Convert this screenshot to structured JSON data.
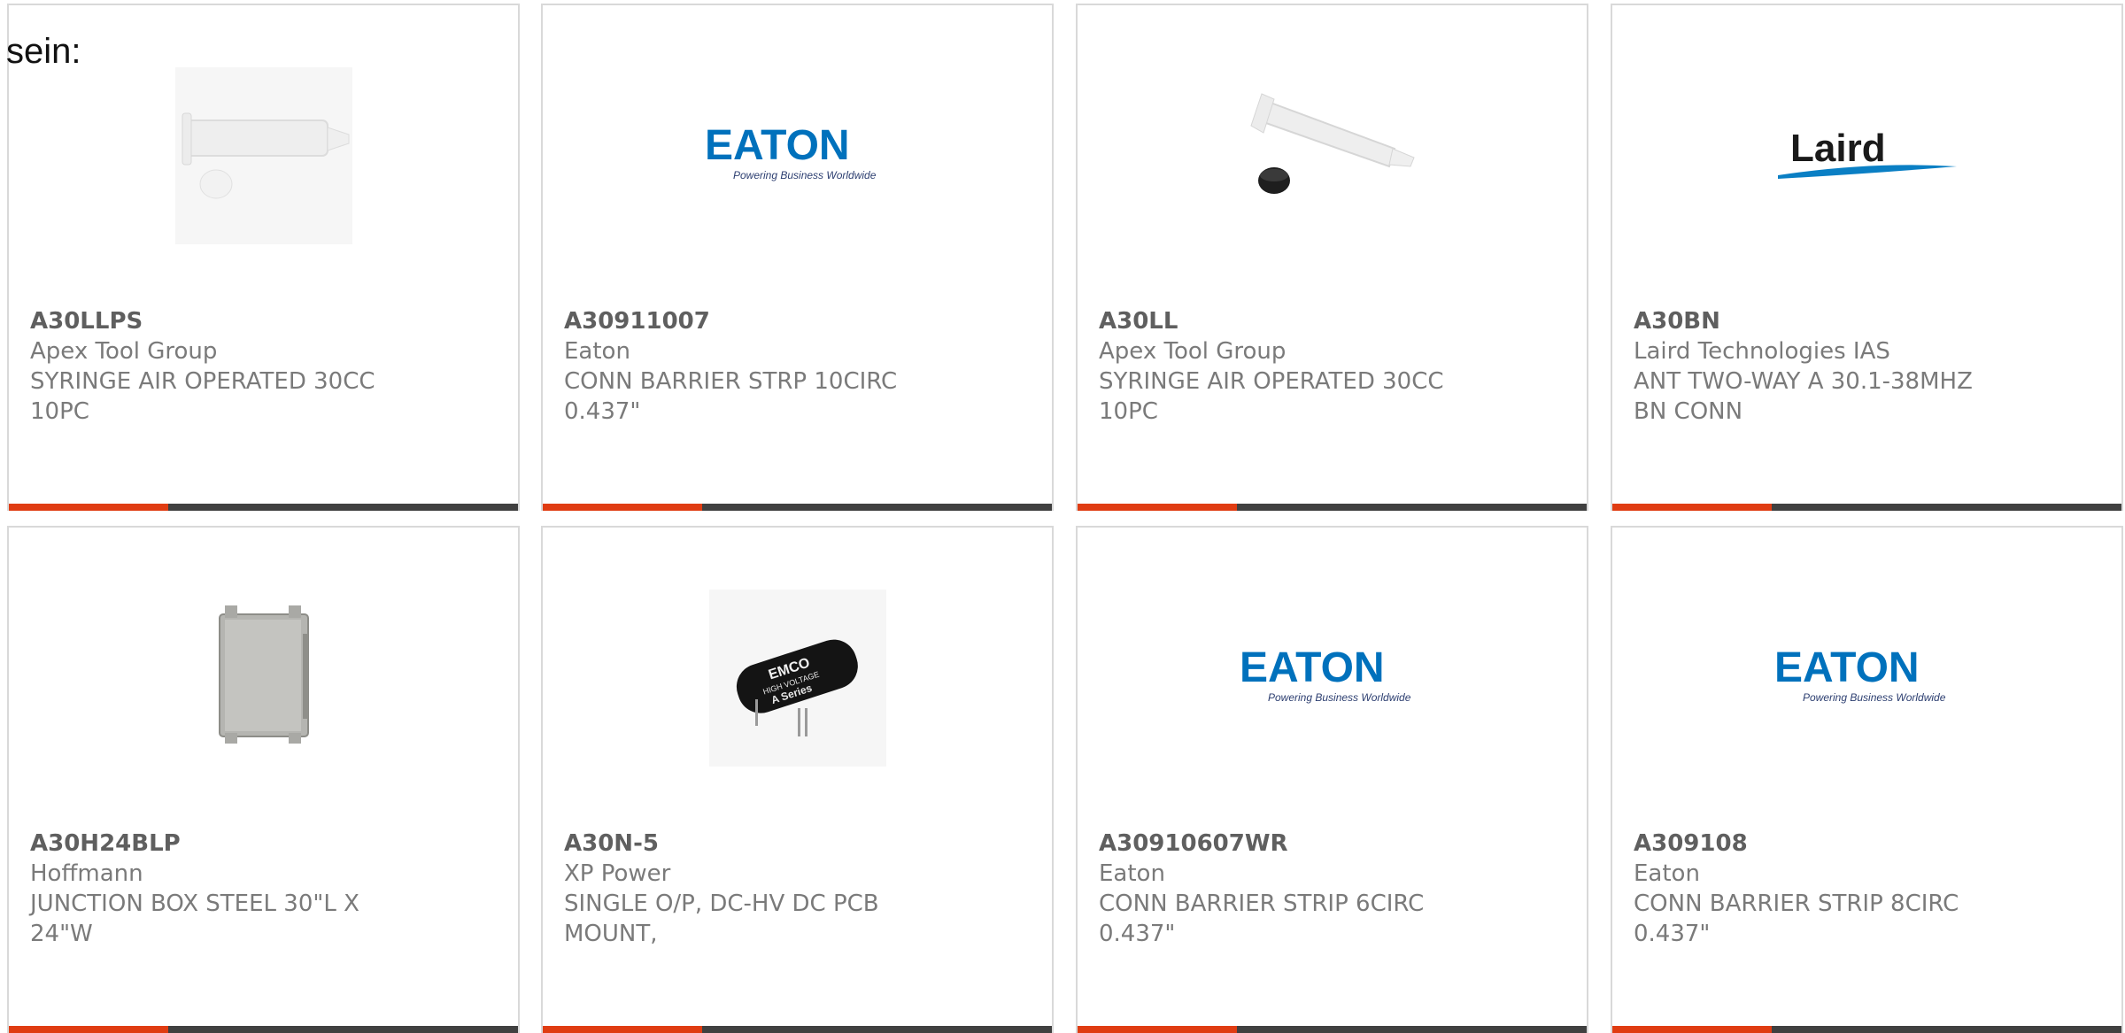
{
  "page": {
    "heading": "sein:"
  },
  "colors": {
    "accent": "#e03c12",
    "bar": "#404040",
    "border": "#d9d9d9",
    "eaton_blue": "#0071bc",
    "laird_blue": "#0a7fc4"
  },
  "products": [
    {
      "part_number": "A30LLPS",
      "manufacturer": "Apex Tool Group",
      "description": "SYRINGE AIR OPERATED 30CC 10PC",
      "image": "syringe-white-cap"
    },
    {
      "part_number": "A30911007",
      "manufacturer": "Eaton",
      "description": "CONN BARRIER STRP 10CIRC 0.437\"",
      "image": "eaton-logo"
    },
    {
      "part_number": "A30LL",
      "manufacturer": "Apex Tool Group",
      "description": "SYRINGE AIR OPERATED 30CC 10PC",
      "image": "syringe-black-cap"
    },
    {
      "part_number": "A30BN",
      "manufacturer": "Laird Technologies IAS",
      "description": "ANT TWO-WAY A 30.1-38MHZ BN CONN",
      "image": "laird-logo"
    },
    {
      "part_number": "A30H24BLP",
      "manufacturer": "Hoffmann",
      "description": "JUNCTION BOX STEEL 30\"L X 24\"W",
      "image": "junction-box"
    },
    {
      "part_number": "A30N-5",
      "manufacturer": "XP Power",
      "description": "SINGLE O/P, DC-HV DC PCB MOUNT,",
      "image": "emco-module"
    },
    {
      "part_number": "A30910607WR",
      "manufacturer": "Eaton",
      "description": "CONN BARRIER STRIP 6CIRC 0.437\"",
      "image": "eaton-logo"
    },
    {
      "part_number": "A309108",
      "manufacturer": "Eaton",
      "description": "CONN BARRIER STRIP 8CIRC 0.437\"",
      "image": "eaton-logo"
    }
  ],
  "logos": {
    "eaton_wordmark": "EATON",
    "eaton_tagline": "Powering Business Worldwide",
    "laird_wordmark": "Laird",
    "emco_line1": "EMCO",
    "emco_line2": "HIGH VOLTAGE",
    "emco_line3": "A Series"
  }
}
